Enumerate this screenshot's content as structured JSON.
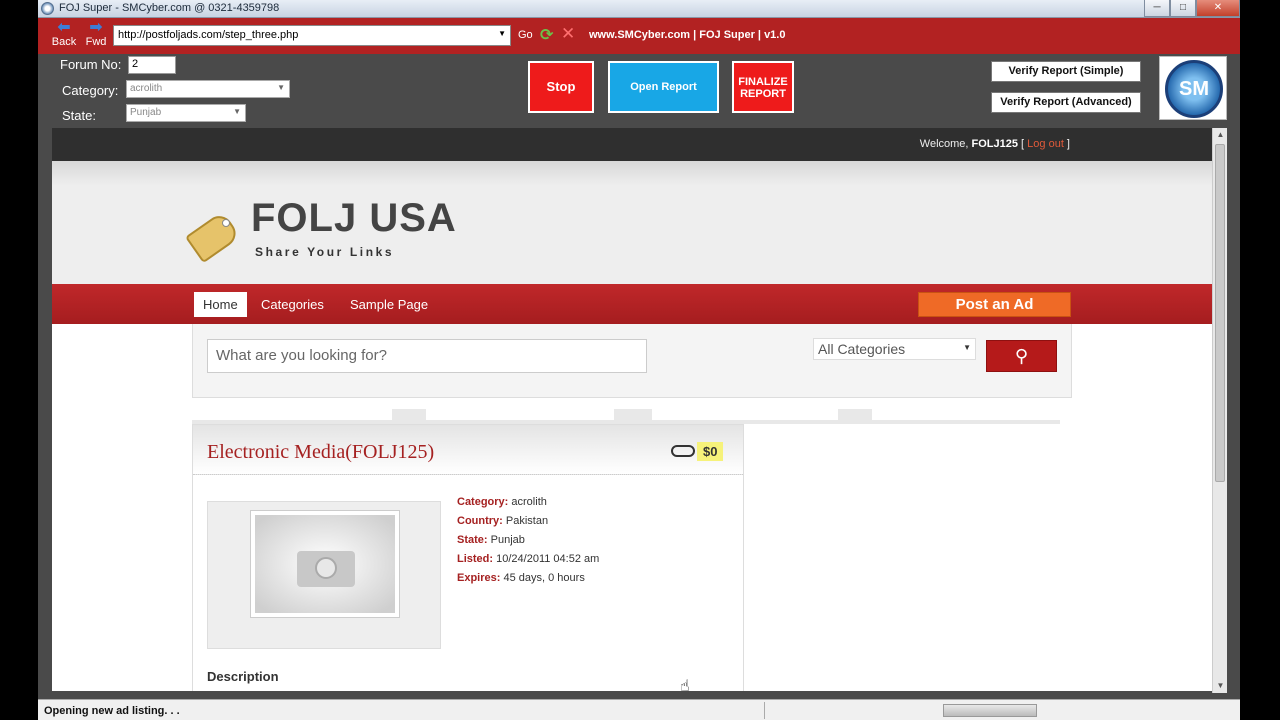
{
  "window": {
    "title": "FOJ Super - SMCyber.com @ 0321-4359798",
    "min": "─",
    "max": "□",
    "close": "✕"
  },
  "nav": {
    "back": "Back",
    "fwd": "Fwd",
    "url": "http://postfoljads.com/step_three.php",
    "go": "Go",
    "info": "www.SMCyber.com | FOJ Super | v1.0"
  },
  "panel": {
    "forum_label": "Forum No:",
    "forum_value": "2",
    "category_label": "Category:",
    "category_value": "acrolith",
    "state_label": "State:",
    "state_value": "Punjab",
    "stop": "Stop",
    "open_report": "Open Report",
    "finalize": "FINALIZE REPORT",
    "verify_simple": "Verify Report (Simple)",
    "verify_advanced": "Verify Report (Advanced)",
    "logo": "SM"
  },
  "site": {
    "welcome_prefix": "Welcome, ",
    "user": "FOLJ125",
    "logout_open": " [ ",
    "logout": "Log out",
    "logout_close": " ]",
    "logo": "FOLJ USA",
    "tagline": "Share Your Links",
    "menu": [
      "Home",
      "Categories",
      "Sample Page"
    ],
    "post_ad": "Post an Ad",
    "search_placeholder": "What are you looking for?",
    "category_select": "All Categories"
  },
  "listing": {
    "title": "Electronic Media(FOLJ125)",
    "price": "$0",
    "details": [
      {
        "key": "Category:",
        "value": "acrolith"
      },
      {
        "key": "Country:",
        "value": "Pakistan"
      },
      {
        "key": "State:",
        "value": "Punjab"
      },
      {
        "key": "Listed:",
        "value": "10/24/2011 04:52 am"
      },
      {
        "key": "Expires:",
        "value": "45 days, 0 hours"
      }
    ],
    "description_label": "Description"
  },
  "status": {
    "text": "Opening new ad listing. . ."
  },
  "colors": {
    "accent_red": "#b22222",
    "post_ad_orange": "#ef6a26",
    "open_report_blue": "#18a7e6"
  }
}
